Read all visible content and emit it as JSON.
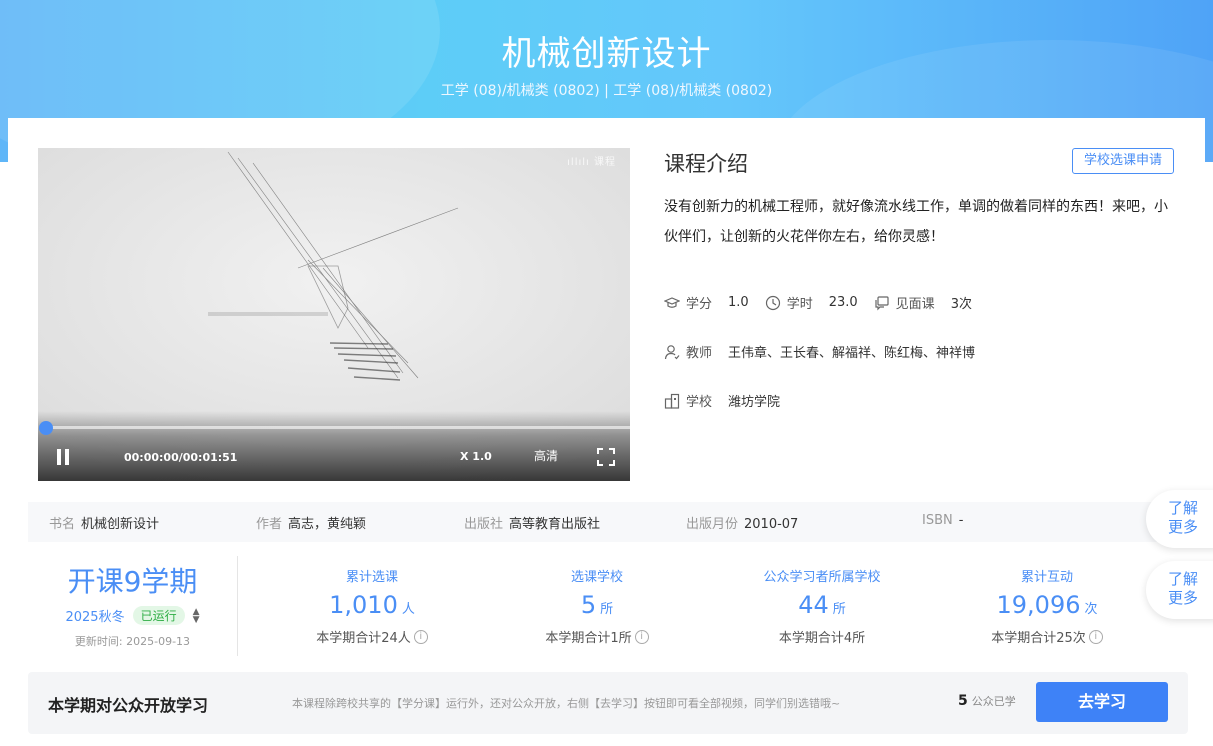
{
  "banner": {
    "title": "机械创新设计",
    "subtitle": "工学 (08)/机械类 (0802) | 工学 (08)/机械类 (0802)"
  },
  "video": {
    "time": "00:00:00/00:01:51",
    "speed": "X 1.0",
    "quality": "高清",
    "progress": 0,
    "watermark": "ıllılı 课程"
  },
  "intro": {
    "title": "课程介绍",
    "apply_label": "学校选课申请",
    "description": "没有创新力的机械工程师，就好像流水线工作，单调的做着同样的东西！来吧，小伙伴们，让创新的火花伴你左右，给你灵感！",
    "credit_label": "学分",
    "credit_value": "1.0",
    "hours_label": "学时",
    "hours_value": "23.0",
    "meet_label": "见面课",
    "meet_value": "3次",
    "teacher_label": "教师",
    "teacher_value": "王伟章、王长春、解福祥、陈红梅、神祥博",
    "school_label": "学校",
    "school_value": "潍坊学院"
  },
  "book": {
    "name_label": "书名",
    "name": "机械创新设计",
    "author_label": "作者",
    "author": "高志，黄纯颖",
    "publisher_label": "出版社",
    "publisher": "高等教育出版社",
    "month_label": "出版月份",
    "month": "2010-07",
    "isbn_label": "ISBN",
    "isbn": "-"
  },
  "stats": {
    "term_title": "开课9学期",
    "term": "2025秋冬",
    "status": "已运行",
    "updated": "更新时间:   2025-09-13",
    "items": [
      {
        "label": "累计选课",
        "value": "1,010",
        "unit": "人",
        "sub": "本学期合计24人"
      },
      {
        "label": "选课学校",
        "value": "5",
        "unit": "所",
        "sub": "本学期合计1所"
      },
      {
        "label": "公众学习者所属学校",
        "value": "44",
        "unit": "所",
        "sub": "本学期合计4所"
      },
      {
        "label": "累计互动",
        "value": "19,096",
        "unit": "次",
        "sub": "本学期合计25次"
      }
    ]
  },
  "floating": {
    "btn1_line1": "了解",
    "btn1_line2": "更多",
    "btn2_line1": "了解",
    "btn2_line2": "更多"
  },
  "bottom": {
    "title": "本学期对公众开放学习",
    "desc": "本课程除跨校共享的【学分课】运行外，还对公众开放，右侧【去学习】按钮即可看全部视频，同学们别选错哦~",
    "count": "5",
    "count_label": "公众已学",
    "button": "去学习"
  },
  "colors": {
    "accent": "#4a8ef5",
    "running_bg": "#e3f7e6",
    "running_text": "#2fae45"
  }
}
